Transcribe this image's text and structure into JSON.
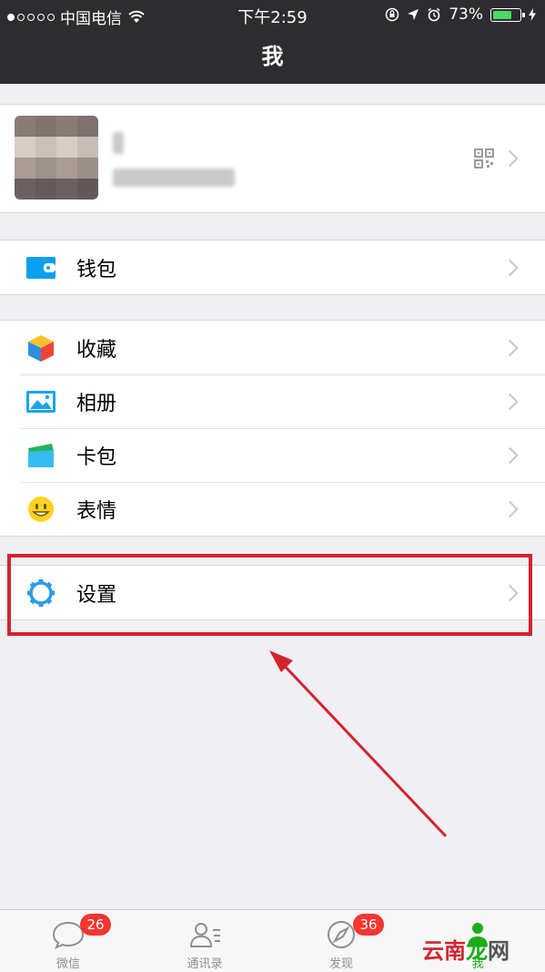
{
  "status_bar": {
    "carrier": "中国电信",
    "time": "下午2:59",
    "battery_percent": "73%",
    "battery_level": 0.73
  },
  "nav": {
    "title": "我"
  },
  "profile": {
    "name": "",
    "id": ""
  },
  "wallet_group": [
    {
      "label": "钱包",
      "icon": "wallet-icon"
    }
  ],
  "main_group": [
    {
      "label": "收藏",
      "icon": "favorites-icon"
    },
    {
      "label": "相册",
      "icon": "album-icon"
    },
    {
      "label": "卡包",
      "icon": "cards-icon"
    },
    {
      "label": "表情",
      "icon": "sticker-icon"
    }
  ],
  "settings_group": [
    {
      "label": "设置",
      "icon": "settings-icon"
    }
  ],
  "tabs": [
    {
      "label": "微信",
      "icon": "chat-bubble-icon",
      "badge": "26"
    },
    {
      "label": "通讯录",
      "icon": "contacts-icon",
      "badge": ""
    },
    {
      "label": "发现",
      "icon": "compass-icon",
      "badge": "36"
    },
    {
      "label": "我",
      "icon": "person-icon",
      "badge": ""
    }
  ],
  "watermark": {
    "text": "云南龙网"
  },
  "colors": {
    "nav_bg": "#2d2d30",
    "badge_red": "#f43530",
    "highlight_red": "#d3242d",
    "active_green": "#1aad19"
  }
}
